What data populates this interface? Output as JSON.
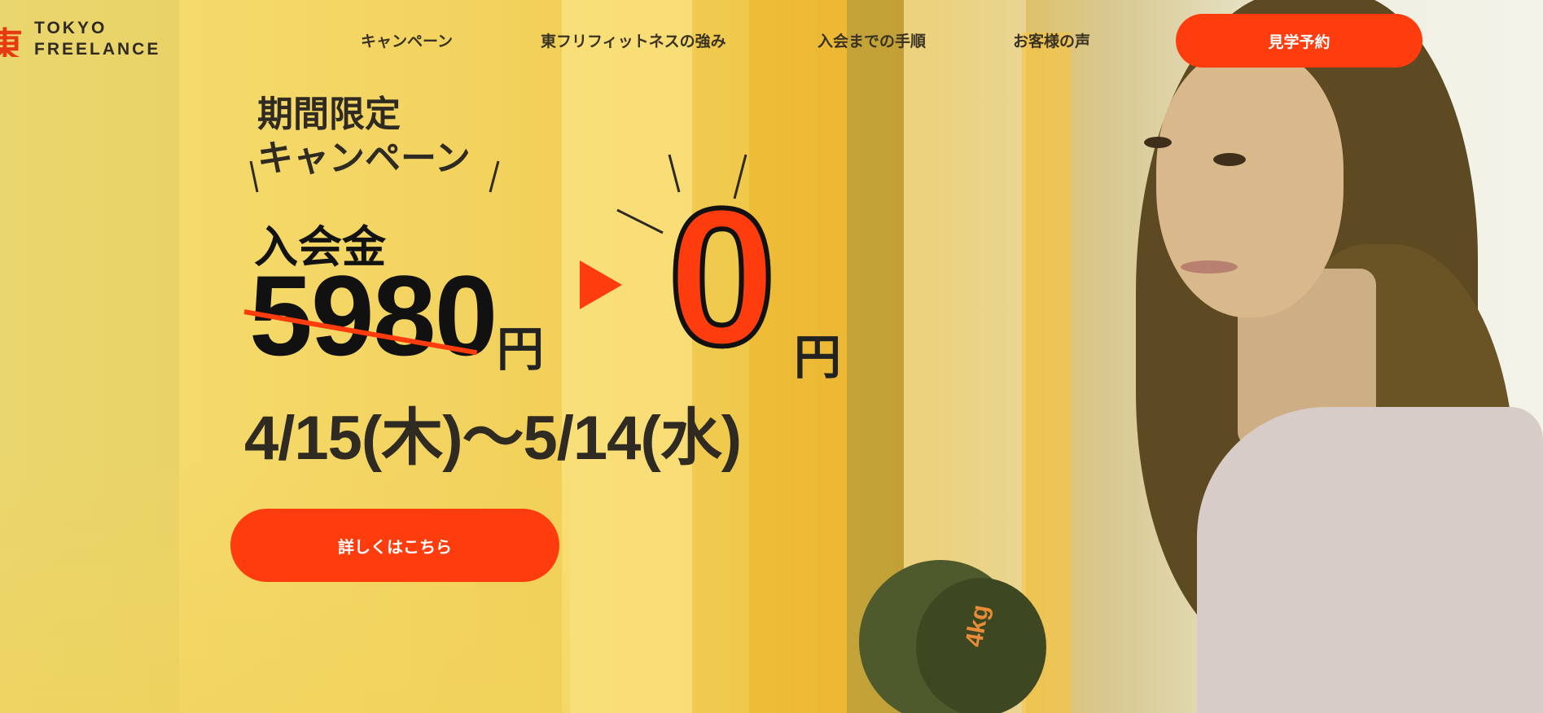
{
  "header": {
    "logo_line1": "TOKYO",
    "logo_line2": "FREELANCE",
    "nav": [
      {
        "label": "キャンペーン"
      },
      {
        "label": "東フリフィットネスの強み"
      },
      {
        "label": "入会までの手順"
      },
      {
        "label": "お客様の声"
      }
    ],
    "reserve_label": "見学予約"
  },
  "hero": {
    "campaign_line1": "期間限定",
    "campaign_line2": "キャンペーン",
    "fee_label": "入会金",
    "old_price": "5980",
    "yen": "円",
    "new_price": "0",
    "date_range": "4/15(木)〜5/14(水)",
    "detail_button": "詳しくはこちら",
    "dumbbell_label": "4kg"
  },
  "colors": {
    "accent": "#ff3c0d",
    "text_dark": "#2f2a22",
    "background_yellow": "#f6d86e"
  },
  "icons": {
    "logo_mark": "tokyo-kanji-logo-icon",
    "arrow": "play-arrow-icon"
  }
}
